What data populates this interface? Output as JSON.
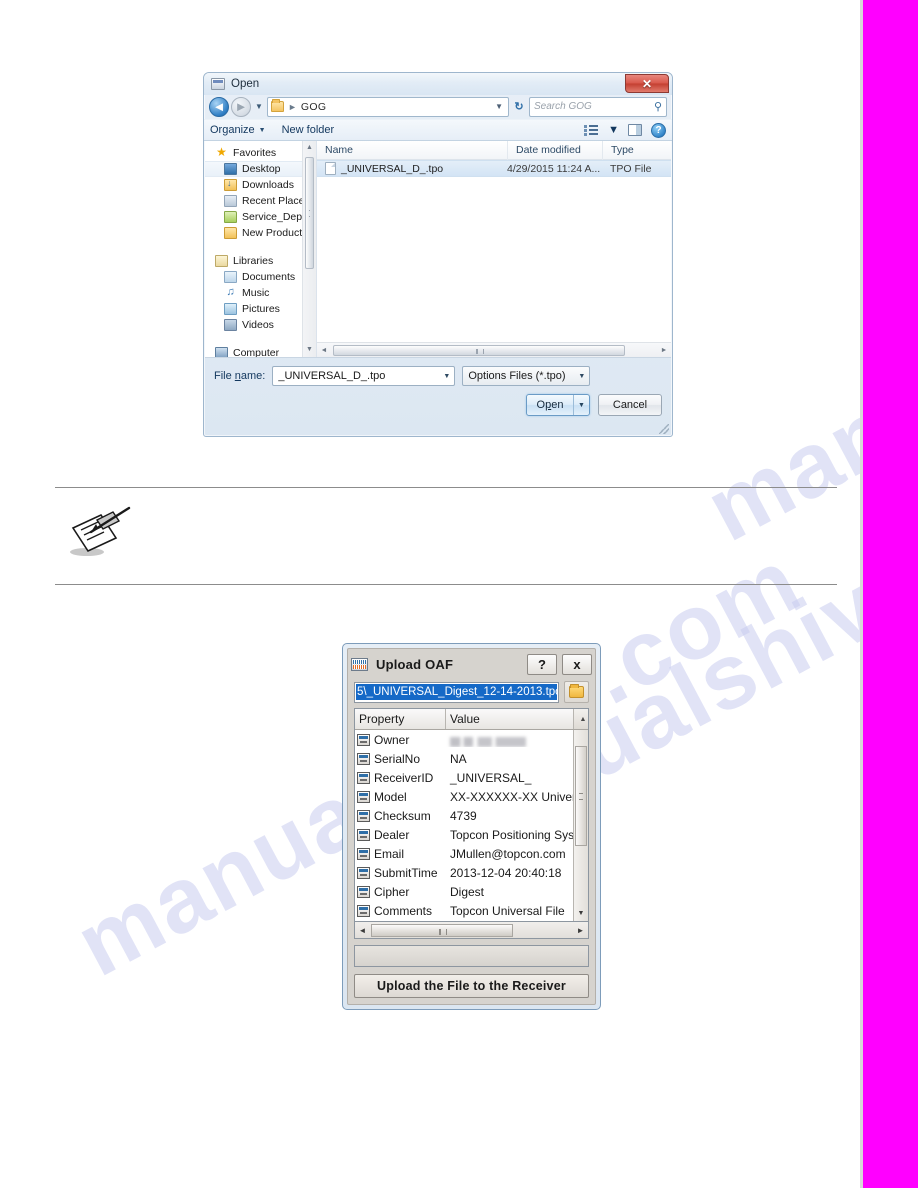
{
  "page": {
    "watermark_text": "manualshive.com",
    "edge_bar_color": "#ff00ff"
  },
  "open_dialog": {
    "title": "Open",
    "title_icon": "window-icon",
    "close_label": "✕",
    "nav": {
      "back_label": "◄",
      "forward_label": "►",
      "recent_label": "▼",
      "refresh_label": "↻"
    },
    "address": {
      "folder_icon": "folder-icon",
      "separator": "►",
      "crumb": "GOG",
      "caret": "▼"
    },
    "search": {
      "placeholder": "Search GOG",
      "icon": "search-icon"
    },
    "commandbar": {
      "organize_label": "Organize",
      "organize_caret": "▼",
      "new_folder_label": "New folder",
      "view_caret": "▼",
      "help_label": "?"
    },
    "nav_pane": {
      "items": [
        {
          "label": "Favorites",
          "icon": "star-icon",
          "indent": false,
          "selected": false
        },
        {
          "label": "Desktop",
          "icon": "desktop-icon",
          "indent": true,
          "selected": true
        },
        {
          "label": "Downloads",
          "icon": "downloads-icon",
          "indent": true,
          "selected": false
        },
        {
          "label": "Recent Places",
          "icon": "recent-places-icon",
          "indent": true,
          "selected": false
        },
        {
          "label": "Service_Dept (tps",
          "icon": "folder-icon",
          "indent": true,
          "selected": false
        },
        {
          "label": "New Product Intro",
          "icon": "folder-icon",
          "indent": true,
          "selected": false
        },
        {
          "label": "Libraries",
          "icon": "library-icon",
          "indent": false,
          "selected": false,
          "gap_before": true
        },
        {
          "label": "Documents",
          "icon": "documents-icon",
          "indent": true,
          "selected": false
        },
        {
          "label": "Music",
          "icon": "music-icon",
          "indent": true,
          "selected": false
        },
        {
          "label": "Pictures",
          "icon": "pictures-icon",
          "indent": true,
          "selected": false
        },
        {
          "label": "Videos",
          "icon": "videos-icon",
          "indent": true,
          "selected": false
        },
        {
          "label": "Computer",
          "icon": "computer-icon",
          "indent": false,
          "selected": false,
          "gap_before": true
        }
      ],
      "scroll_up": "▲",
      "scroll_down": "▼"
    },
    "file_list": {
      "columns": [
        "Name",
        "Date modified",
        "Type"
      ],
      "rows": [
        {
          "name": "_UNIVERSAL_D_.tpo",
          "date_modified": "4/29/2015 11:24 A...",
          "type": "TPO File",
          "icon": "file-icon",
          "selected": true
        }
      ],
      "hscroll_left": "◄",
      "hscroll_right": "►"
    },
    "footer": {
      "file_name_label_pre": "File ",
      "file_name_label_u": "n",
      "file_name_label_post": "ame:",
      "file_name_value": "_UNIVERSAL_D_.tpo",
      "file_name_caret": "▼",
      "filter_value": "Options Files (*.tpo)",
      "filter_caret": "▼",
      "open_label_pre": "O",
      "open_label_u": "p",
      "open_label_post": "en",
      "open_caret": "▼",
      "cancel_label": "Cancel"
    }
  },
  "note_block": {
    "icon": "note-pencil-icon",
    "text": ""
  },
  "oaf_dialog": {
    "title": "Upload OAF",
    "title_icon": "keyboard-icon",
    "help_label": "?",
    "close_label": "x",
    "path_value": "5\\_UNIVERSAL_Digest_12-14-2013.tpo",
    "browse_icon": "open-folder-icon",
    "table": {
      "columns": [
        "Property",
        "Value"
      ],
      "scroll_up": "▲",
      "scroll_down": "▼",
      "rows": [
        {
          "property": "Owner",
          "value": "John Mullen",
          "redacted": true,
          "icon": "property-icon"
        },
        {
          "property": "SerialNo",
          "value": "NA",
          "icon": "property-icon"
        },
        {
          "property": "ReceiverID",
          "value": "_UNIVERSAL_",
          "icon": "property-icon"
        },
        {
          "property": "Model",
          "value": "XX-XXXXXX-XX Universi",
          "icon": "property-icon"
        },
        {
          "property": "Checksum",
          "value": "4739",
          "icon": "property-icon"
        },
        {
          "property": "Dealer",
          "value": "Topcon Positioning Syste",
          "icon": "property-icon"
        },
        {
          "property": "Email",
          "value": "JMullen@topcon.com",
          "icon": "property-icon"
        },
        {
          "property": "SubmitTime",
          "value": "2013-12-04 20:40:18",
          "icon": "property-icon"
        },
        {
          "property": "Cipher",
          "value": "Digest",
          "icon": "property-icon"
        },
        {
          "property": "Comments",
          "value": "Topcon Universal File",
          "icon": "property-icon"
        }
      ]
    },
    "hscroll_left": "◄",
    "hscroll_right": "►",
    "status_text": "",
    "upload_label": "Upload the File to the Receiver"
  }
}
